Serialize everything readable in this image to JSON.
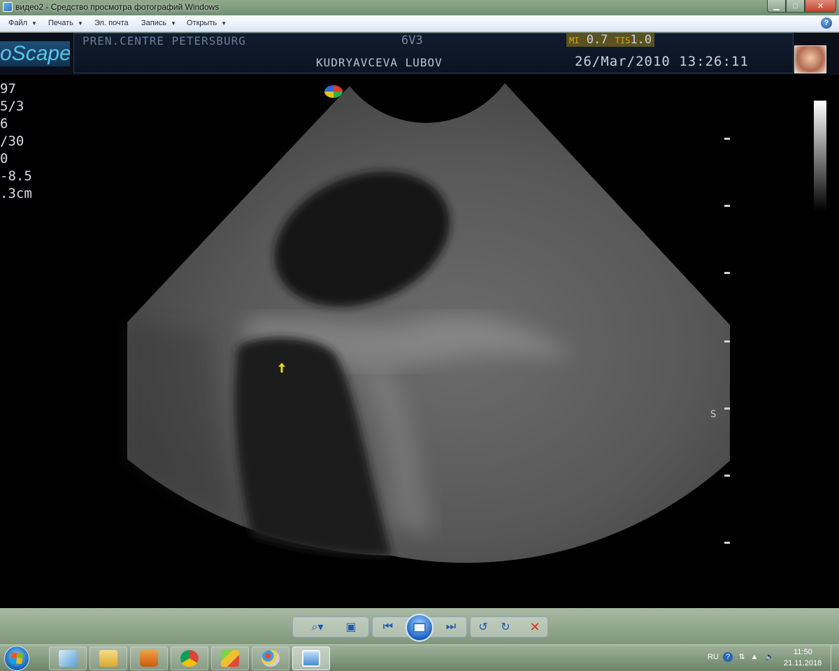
{
  "window": {
    "title": "видео2 - Средство просмотра фотографий Windows",
    "minimize": "▁",
    "maximize": "□",
    "close": "✕"
  },
  "menu": {
    "items": [
      "Файл",
      "Печать",
      "Эл. почта",
      "Запись",
      "Открыть"
    ],
    "help": "?"
  },
  "image": {
    "logo_text": "oScape",
    "institution": "PREN.CENTRE PETERSBURG",
    "probe": "6V3",
    "mi_label": "MI",
    "mi_value": "0.7",
    "tis_label": "TIS",
    "tis_value": "1.0",
    "patient": "KUDRYAVCEVA LUBOV",
    "datetime": "26/Mar/2010 13:26:11",
    "params": [
      "97",
      "5/3",
      "6",
      "/30",
      "0",
      "-8.5",
      ".3cm"
    ],
    "scale_marker": "S"
  },
  "nav": {
    "zoom": "⌕▾",
    "fit": "▣",
    "prev": "⏮",
    "next": "⏭",
    "rotate_ccw": "↺",
    "rotate_cw": "↻",
    "delete": "✕"
  },
  "taskbar": {
    "lang": "RU",
    "time": "11:50",
    "date": "21.11.2018",
    "apps": [
      "file-manager",
      "folder",
      "media-player",
      "chrome",
      "bluestacks",
      "paint",
      "photo-viewer"
    ]
  },
  "colors": {
    "accent": "#1f63c4",
    "mi_bg": "#5a5220",
    "cursor": "#e6d71a"
  }
}
